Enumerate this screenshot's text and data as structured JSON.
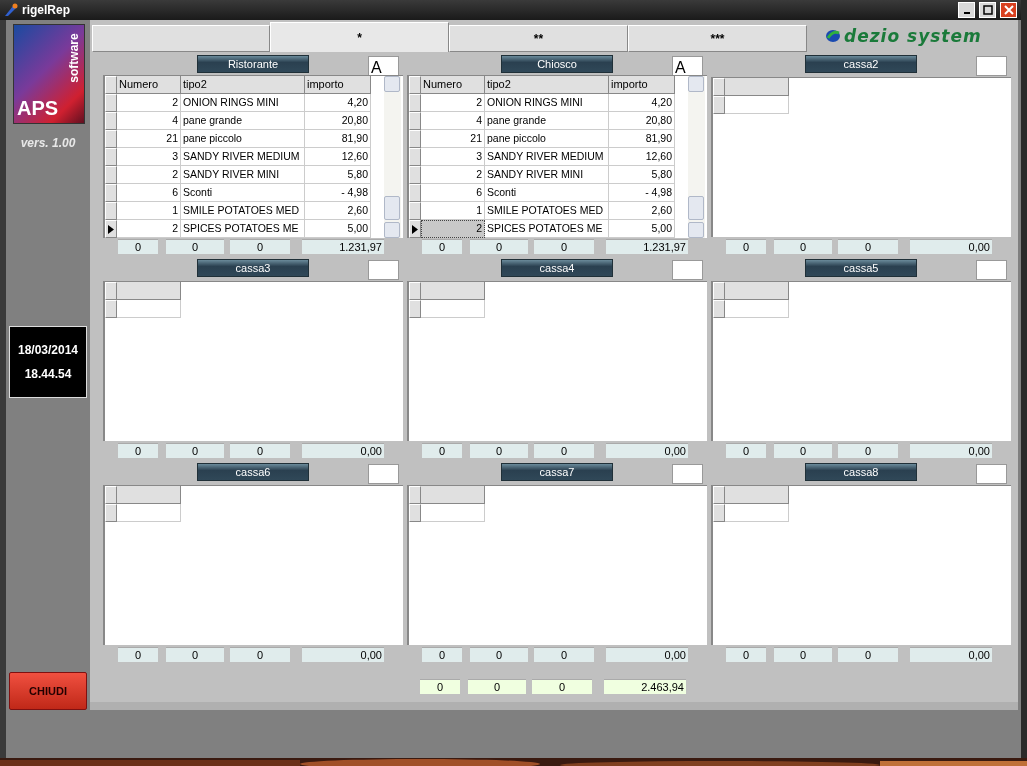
{
  "window": {
    "title": "rigelRep"
  },
  "sidebar": {
    "logo": {
      "text": "APS",
      "subtext": "software"
    },
    "version": "vers. 1.00",
    "date": "18/03/2014",
    "time": "18.44.54",
    "close_button": "CHIUDI"
  },
  "tabs": [
    {
      "selected": false
    },
    {
      "label": "*",
      "selected": true
    },
    {
      "label": "**",
      "selected": false
    },
    {
      "label": "***",
      "selected": false
    }
  ],
  "brand_logo": "dezio system",
  "panels": [
    {
      "name": "Ristorante",
      "filter": "A",
      "columns": [
        "Numero",
        "tipo2",
        "importo"
      ],
      "rows": [
        {
          "numero": "2",
          "tipo2": "ONION RINGS MINI",
          "importo": "4,20",
          "selected": false,
          "focused": false
        },
        {
          "numero": "4",
          "tipo2": "pane grande",
          "importo": "20,80",
          "selected": false,
          "focused": false
        },
        {
          "numero": "21",
          "tipo2": "pane piccolo",
          "importo": "81,90",
          "selected": false,
          "focused": false
        },
        {
          "numero": "3",
          "tipo2": "SANDY RIVER MEDIUM",
          "importo": "12,60",
          "selected": false,
          "focused": false
        },
        {
          "numero": "2",
          "tipo2": "SANDY RIVER MINI",
          "importo": "5,80",
          "selected": false,
          "focused": false
        },
        {
          "numero": "6",
          "tipo2": "Sconti",
          "importo": "-  4,98",
          "selected": false,
          "focused": false
        },
        {
          "numero": "1",
          "tipo2": "SMILE POTATOES MED",
          "importo": "2,60",
          "selected": false,
          "focused": false
        },
        {
          "numero": "2",
          "tipo2": "SPICES POTATOES ME",
          "importo": "5,00",
          "selected": true,
          "focused": false
        }
      ],
      "totals": [
        "0",
        "0",
        "0",
        "1.231,97"
      ]
    },
    {
      "name": "Chiosco",
      "filter": "A",
      "columns": [
        "Numero",
        "tipo2",
        "importo"
      ],
      "rows": [
        {
          "numero": "2",
          "tipo2": "ONION RINGS MINI",
          "importo": "4,20",
          "selected": false,
          "focused": false
        },
        {
          "numero": "4",
          "tipo2": "pane grande",
          "importo": "20,80",
          "selected": false,
          "focused": false
        },
        {
          "numero": "21",
          "tipo2": "pane piccolo",
          "importo": "81,90",
          "selected": false,
          "focused": false
        },
        {
          "numero": "3",
          "tipo2": "SANDY RIVER MEDIUM",
          "importo": "12,60",
          "selected": false,
          "focused": false
        },
        {
          "numero": "2",
          "tipo2": "SANDY RIVER MINI",
          "importo": "5,80",
          "selected": false,
          "focused": false
        },
        {
          "numero": "6",
          "tipo2": "Sconti",
          "importo": "-  4,98",
          "selected": false,
          "focused": false
        },
        {
          "numero": "1",
          "tipo2": "SMILE POTATOES MED",
          "importo": "2,60",
          "selected": false,
          "focused": false
        },
        {
          "numero": "2",
          "tipo2": "SPICES POTATOES ME",
          "importo": "5,00",
          "selected": true,
          "focused": true
        }
      ],
      "totals": [
        "0",
        "0",
        "0",
        "1.231,97"
      ]
    },
    {
      "name": "cassa2",
      "totals": [
        "0",
        "0",
        "0",
        "0,00"
      ]
    },
    {
      "name": "cassa3",
      "totals": [
        "0",
        "0",
        "0",
        "0,00"
      ]
    },
    {
      "name": "cassa4",
      "totals": [
        "0",
        "0",
        "0",
        "0,00"
      ]
    },
    {
      "name": "cassa5",
      "totals": [
        "0",
        "0",
        "0",
        "0,00"
      ]
    },
    {
      "name": "cassa6",
      "totals": [
        "0",
        "0",
        "0",
        "0,00"
      ]
    },
    {
      "name": "cassa7",
      "totals": [
        "0",
        "0",
        "0",
        "0,00"
      ]
    },
    {
      "name": "cassa8",
      "totals": [
        "0",
        "0",
        "0",
        "0,00"
      ]
    }
  ],
  "grand_totals": [
    "0",
    "0",
    "0",
    "2.463,94"
  ]
}
